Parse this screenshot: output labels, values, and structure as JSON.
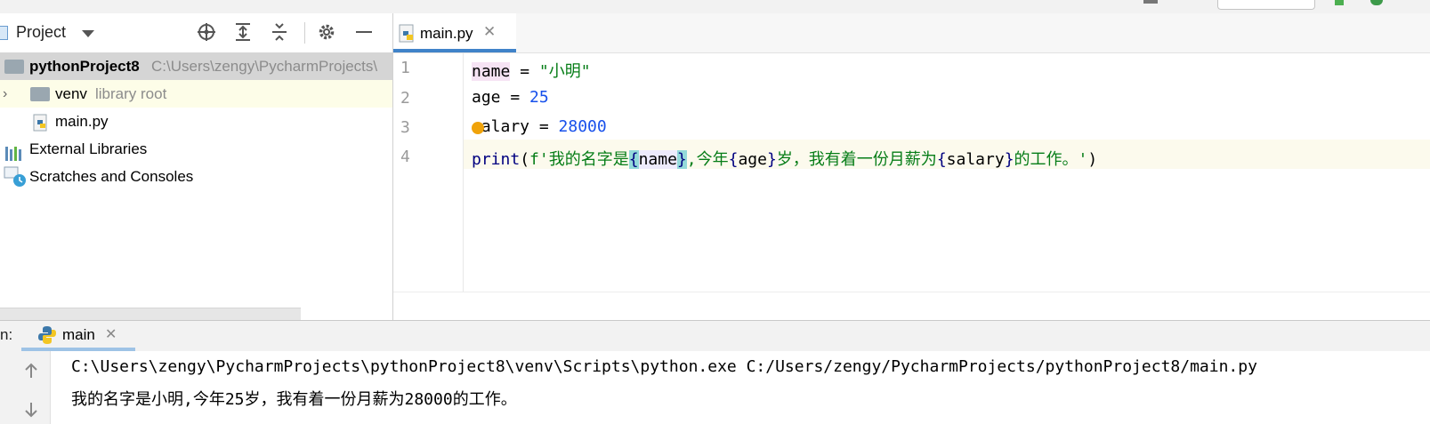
{
  "project_panel": {
    "title": "Project",
    "tree": {
      "root_name": "pythonProject8",
      "root_path": "C:\\Users\\zengy\\PycharmProjects\\",
      "venv_name": "venv",
      "venv_hint": "library root",
      "file_name": "main.py",
      "external_libraries": "External Libraries",
      "scratches": "Scratches and Consoles"
    }
  },
  "editor": {
    "tab_label": "main.py",
    "lines": [
      "1",
      "2",
      "3",
      "4"
    ],
    "code": {
      "l1_var": "name",
      "l1_op": " = ",
      "l1_str": "\"小明\"",
      "l2_var": "age",
      "l2_op": " = ",
      "l2_num": "25",
      "l3_var": "salary",
      "l3_op": " = ",
      "l3_num": "28000",
      "l4_fn": "print",
      "l4_open": "(",
      "l4_prefix": "f'我的名字是",
      "l4_b1": "{",
      "l4_v1": "name",
      "l4_b2": "}",
      "l4_mid1": ",今年",
      "l4_b3": "{",
      "l4_v2": "age",
      "l4_b4": "}",
      "l4_mid2": "岁，我有着一份月薪为",
      "l4_b5": "{",
      "l4_v3": "salary",
      "l4_b6": "}",
      "l4_end": "的工作。'",
      "l4_close": ")"
    }
  },
  "run_panel": {
    "prefix": "n:",
    "tab_label": "main",
    "output": [
      "C:\\Users\\zengy\\PycharmProjects\\pythonProject8\\venv\\Scripts\\python.exe C:/Users/zengy/PycharmProjects/pythonProject8/main.py",
      "我的名字是小明,今年25岁，我有着一份月薪为28000的工作。"
    ]
  },
  "colors": {
    "accent": "#4083c9",
    "string": "#067d17",
    "number": "#1750eb",
    "highlight_row": "#fcfaed"
  }
}
